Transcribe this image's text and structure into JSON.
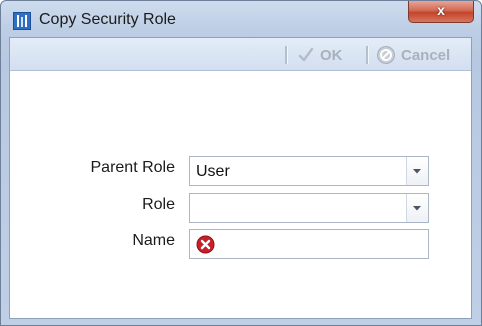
{
  "window": {
    "title": "Copy Security Role",
    "close_label": "x"
  },
  "toolbar": {
    "ok_label": "OK",
    "cancel_label": "Cancel"
  },
  "form": {
    "parent_role": {
      "label": "Parent Role",
      "value": "User"
    },
    "role": {
      "label": "Role",
      "value": ""
    },
    "name": {
      "label": "Name",
      "value": ""
    }
  },
  "icons": {
    "app": "app-logo-icon",
    "ok": "checkmark-icon",
    "cancel": "cancel-icon",
    "dropdown": "chevron-down-icon",
    "validation_error": "error-icon"
  },
  "colors": {
    "error_red": "#c8202a",
    "title_bar": "#bccde4",
    "close_button": "#c2452b"
  }
}
